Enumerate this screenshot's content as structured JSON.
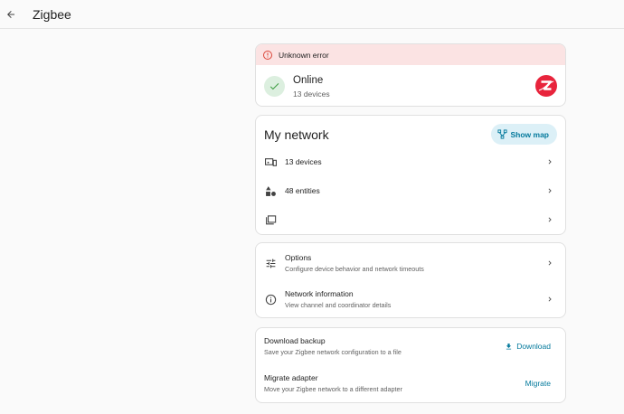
{
  "header": {
    "title": "Zigbee"
  },
  "status": {
    "error": "Unknown error",
    "title": "Online",
    "subtitle": "13 devices"
  },
  "network": {
    "title": "My network",
    "show_map": "Show map",
    "rows": [
      {
        "label": "13 devices",
        "icon": "devices-icon"
      },
      {
        "label": "48 entities",
        "icon": "shapes-icon"
      },
      {
        "label": "",
        "icon": "groups-icon"
      }
    ]
  },
  "settings": {
    "options": {
      "title": "Options",
      "subtitle": "Configure device behavior and network timeouts"
    },
    "network_info": {
      "title": "Network information",
      "subtitle": "View channel and coordinator details"
    }
  },
  "backup": {
    "download": {
      "title": "Download backup",
      "subtitle": "Save your Zigbee network configuration to a file",
      "action": "Download"
    },
    "migrate": {
      "title": "Migrate adapter",
      "subtitle": "Move your Zigbee network to a different adapter",
      "action": "Migrate"
    }
  },
  "colors": {
    "accent": "#03799c",
    "error_bg": "#fbe3e3",
    "error_icon": "#db4437",
    "success_bg": "#dcefdf",
    "success_icon": "#43a047",
    "brand": "#e8243c"
  }
}
